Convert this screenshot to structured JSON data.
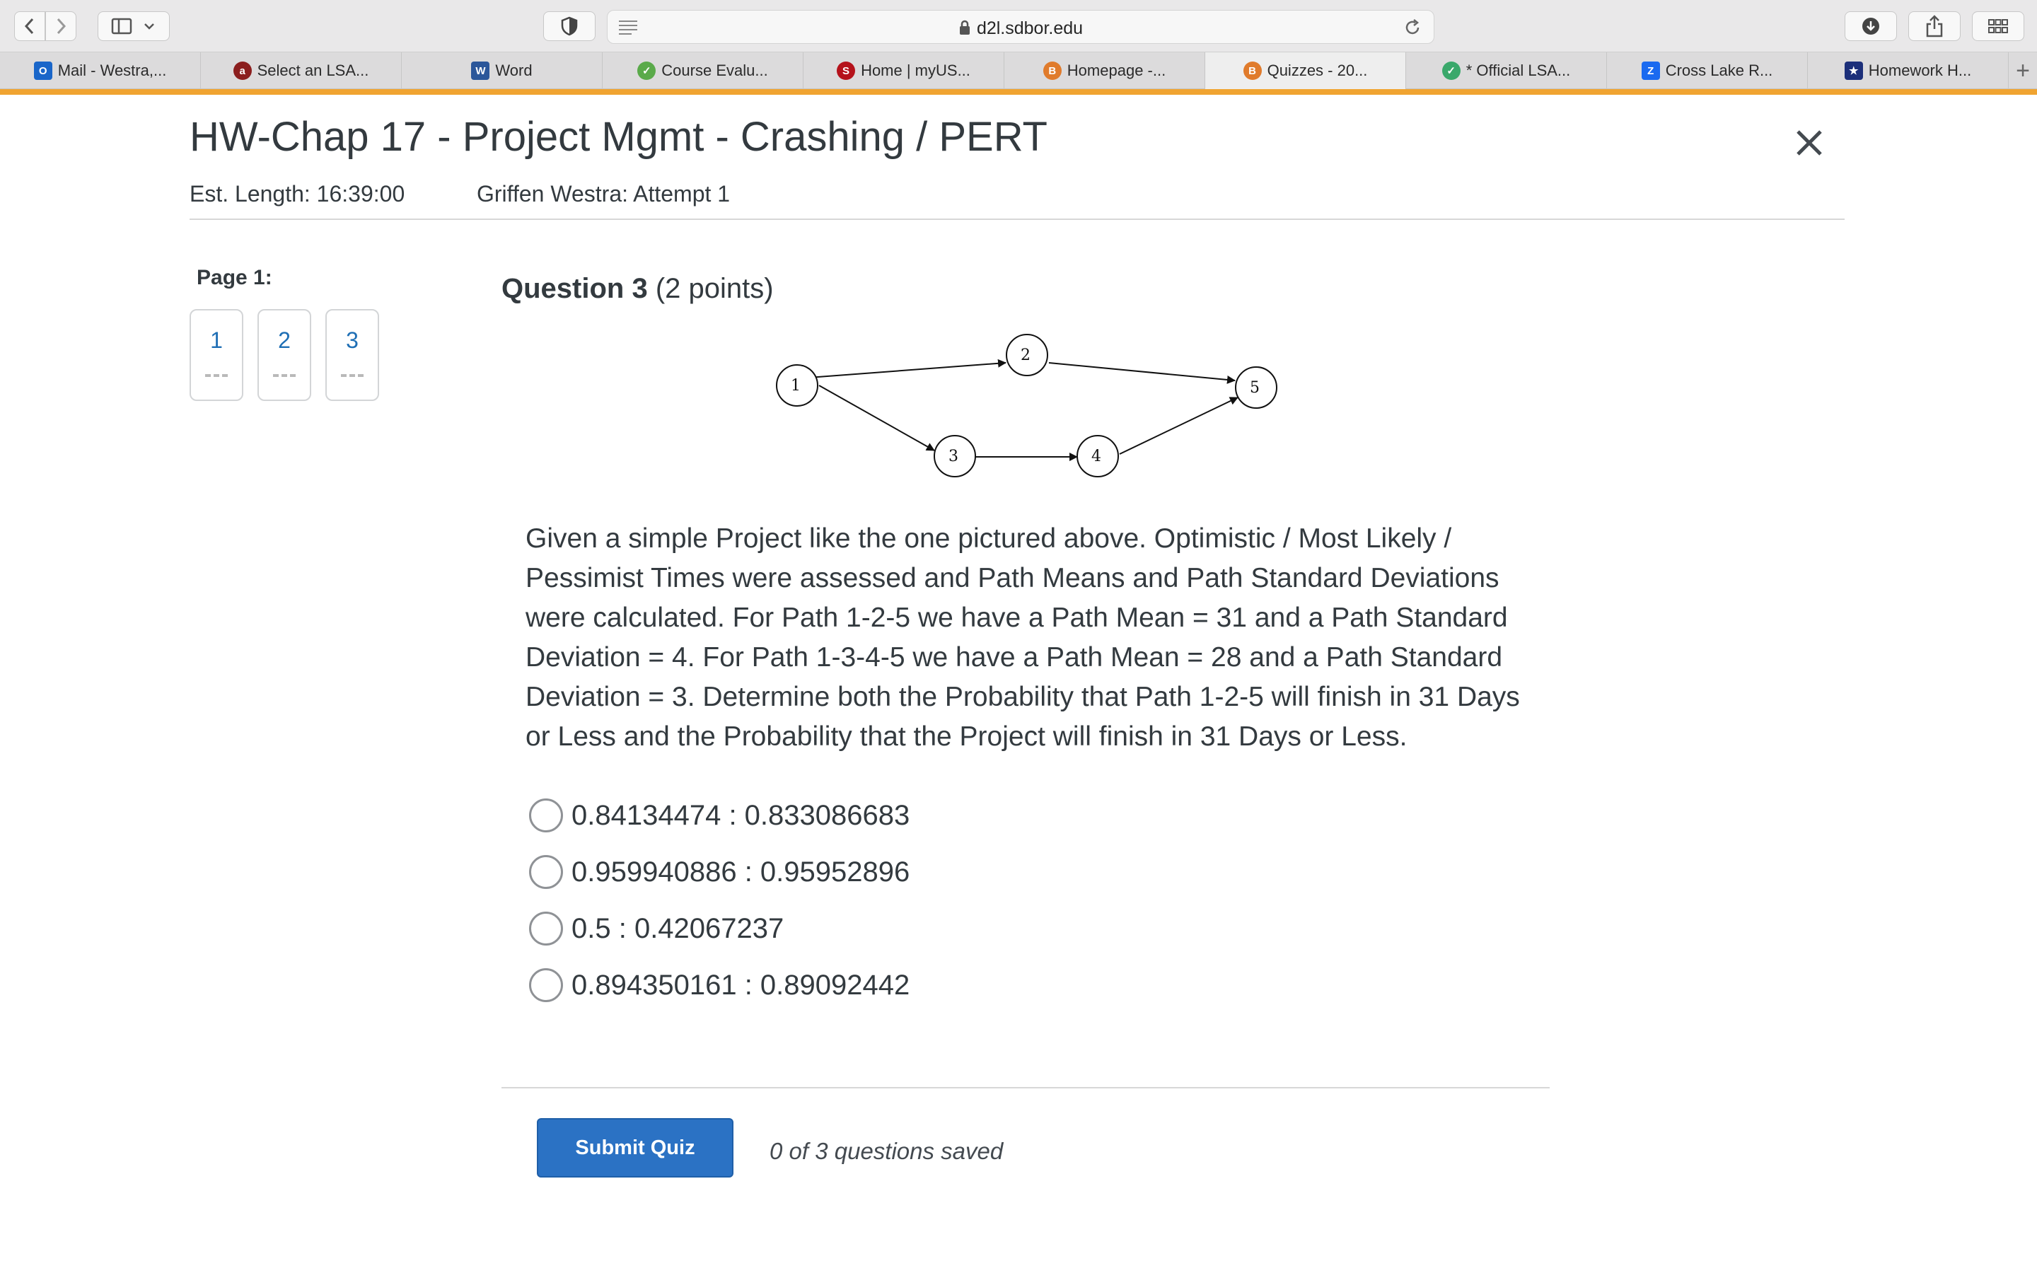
{
  "browser": {
    "url": "d2l.sdbor.edu",
    "tabs": [
      {
        "label": "Mail - Westra,...",
        "icon": "outlook-icon",
        "color": "#1a66c9",
        "glyph": "O"
      },
      {
        "label": "Select an LSA...",
        "icon": "lsa-logo-icon",
        "color": "#8b1e1e",
        "glyph": "a"
      },
      {
        "label": "Word",
        "icon": "word-icon",
        "color": "#2b579a",
        "glyph": "W"
      },
      {
        "label": "Course Evalu...",
        "icon": "check-circle-icon",
        "color": "#5aaa4a",
        "glyph": "✓"
      },
      {
        "label": "Home | myUS...",
        "icon": "usd-logo-icon",
        "color": "#b5121b",
        "glyph": "S"
      },
      {
        "label": "Homepage -...",
        "icon": "b-badge-icon",
        "color": "#e07b2c",
        "glyph": "B"
      },
      {
        "label": "Quizzes - 20...",
        "icon": "b-badge-icon",
        "color": "#e07b2c",
        "glyph": "B"
      },
      {
        "label": "* Official LSA...",
        "icon": "shield-check-icon",
        "color": "#3aa86b",
        "glyph": "✓"
      },
      {
        "label": "Cross Lake R...",
        "icon": "zillow-icon",
        "color": "#1a6af0",
        "glyph": "Z"
      },
      {
        "label": "Homework H...",
        "icon": "star-icon",
        "color": "#1c2f7a",
        "glyph": "★"
      }
    ],
    "accent_color": "#f0a431"
  },
  "quiz": {
    "title": "HW-Chap 17 - Project Mgmt - Crashing / PERT",
    "est_length": "Est. Length: 16:39:00",
    "attempt": "Griffen Westra: Attempt 1",
    "page_label": "Page 1:",
    "nav": [
      {
        "number": "1",
        "status": "--"
      },
      {
        "number": "2",
        "status": "--"
      },
      {
        "number": "3",
        "status": "--"
      }
    ]
  },
  "question": {
    "title": "Question 3",
    "points": "(2 points)",
    "diagram": {
      "nodes": [
        "1",
        "2",
        "3",
        "4",
        "5"
      ],
      "edges": [
        [
          "1",
          "2"
        ],
        [
          "1",
          "3"
        ],
        [
          "2",
          "5"
        ],
        [
          "3",
          "4"
        ],
        [
          "4",
          "5"
        ]
      ]
    },
    "text": "Given a simple Project like the one pictured above. Optimistic / Most Likely / Pessimist Times were assessed and Path Means and Path Standard Deviations were calculated. For Path 1-2-5 we have a Path Mean = 31 and a Path Standard Deviation = 4. For Path 1-3-4-5 we have a Path Mean = 28 and a Path Standard Deviation = 3. Determine both the Probability that Path 1-2-5 will finish in 31 Days or Less and the Probability that the Project will finish in 31 Days or Less.",
    "choices": [
      "0.84134474 : 0.833086683",
      "0.959940886 : 0.95952896",
      "0.5 : 0.42067237",
      "0.894350161 : 0.89092442"
    ]
  },
  "footer": {
    "submit_label": "Submit Quiz",
    "saved_status": "0 of 3 questions saved"
  }
}
